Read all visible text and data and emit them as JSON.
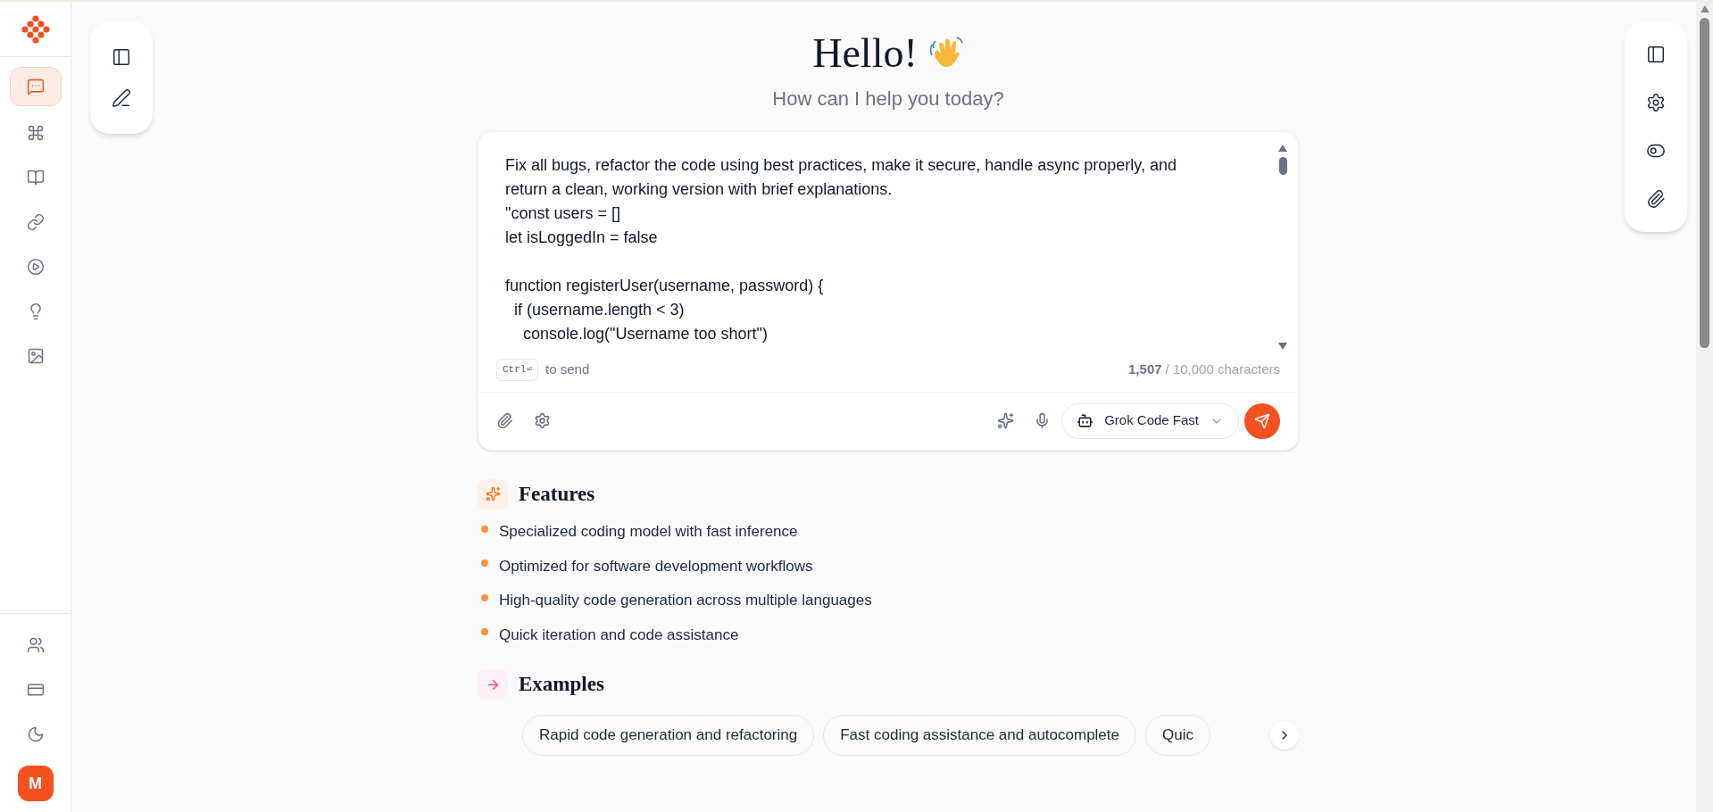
{
  "sidebar": {
    "items": [
      {
        "selected": true
      },
      {
        "selected": false
      },
      {
        "selected": false
      },
      {
        "selected": false
      },
      {
        "selected": false
      },
      {
        "selected": false
      },
      {
        "selected": false
      }
    ],
    "avatar": "M"
  },
  "header": {
    "title": "Hello!",
    "subtitle": "How can I help you today?"
  },
  "composer": {
    "value": "Fix all bugs, refactor the code using best practices, make it secure, handle async properly, and return a clean, working version with brief explanations.\n\"const users = []\nlet isLoggedIn = false\n\nfunction registerUser(username, password) {\n  if (username.length < 3)\n    console.log(\"Username too short\")",
    "shortcut_key": "Ctrl⏎",
    "shortcut_hint": "to send",
    "count": "1,507",
    "limit": "/ 10,000 characters",
    "model": "Grok Code Fast"
  },
  "features": {
    "title": "Features",
    "items": [
      "Specialized coding model with fast inference",
      "Optimized for software development workflows",
      "High-quality code generation across multiple languages",
      "Quick iteration and code assistance"
    ]
  },
  "examples": {
    "title": "Examples",
    "items": [
      "Rapid code generation and refactoring",
      "Fast coding assistance and autocomplete",
      "Quic"
    ]
  }
}
